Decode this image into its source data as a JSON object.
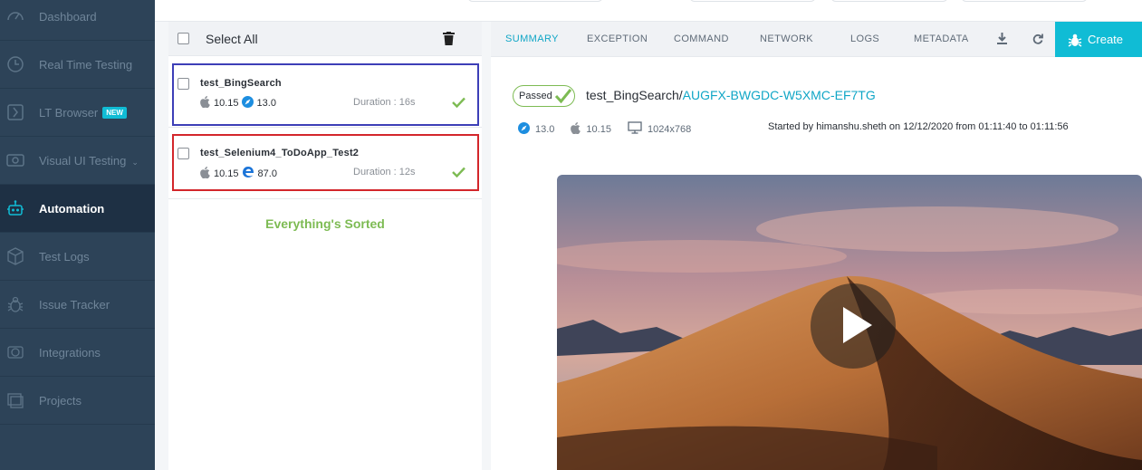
{
  "sidebar": {
    "items": [
      {
        "label": "Dashboard",
        "icon": "gauge-icon"
      },
      {
        "label": "Real Time Testing",
        "icon": "clock-icon"
      },
      {
        "label": "LT Browser",
        "icon": "lt-browser-icon",
        "badge": "NEW"
      },
      {
        "label": "Visual UI Testing",
        "icon": "eye-icon"
      },
      {
        "label": "Automation",
        "icon": "robot-icon",
        "active": true
      },
      {
        "label": "Test Logs",
        "icon": "cube-icon"
      },
      {
        "label": "Issue Tracker",
        "icon": "bug-icon"
      },
      {
        "label": "Integrations",
        "icon": "integrations-icon"
      },
      {
        "label": "Projects",
        "icon": "folder-icon"
      }
    ]
  },
  "list": {
    "select_all": "Select All",
    "empty_message": "Everything's Sorted",
    "tests": [
      {
        "name": "test_BingSearch",
        "os_version": "10.15",
        "browser_version": "13.0",
        "browser_icon": "safari-icon",
        "duration": "Duration : 16s",
        "highlight_color": "#3d3fb7"
      },
      {
        "name": "test_Selenium4_ToDoApp_Test2",
        "os_version": "10.15",
        "browser_version": "87.0",
        "browser_icon": "edge-icon",
        "duration": "Duration : 12s",
        "highlight_color": "#d3262b"
      }
    ]
  },
  "tabs": [
    "SUMMARY",
    "EXCEPTION",
    "COMMAND",
    "NETWORK",
    "LOGS",
    "METADATA"
  ],
  "create_button": "Create",
  "summary": {
    "status": "Passed",
    "test_name": "test_BingSearch/",
    "build_id": "AUGFX-BWGDC-W5XMC-EF7TG",
    "browser_version": "13.0",
    "os_version": "10.15",
    "resolution": "1024x768",
    "started": "Started by himanshu.sheth on 12/12/2020 from 01:11:40 to 01:11:56"
  },
  "colors": {
    "sidebar_bg": "#2d4358",
    "accent": "#10bcd5",
    "success": "#7dbb53"
  }
}
